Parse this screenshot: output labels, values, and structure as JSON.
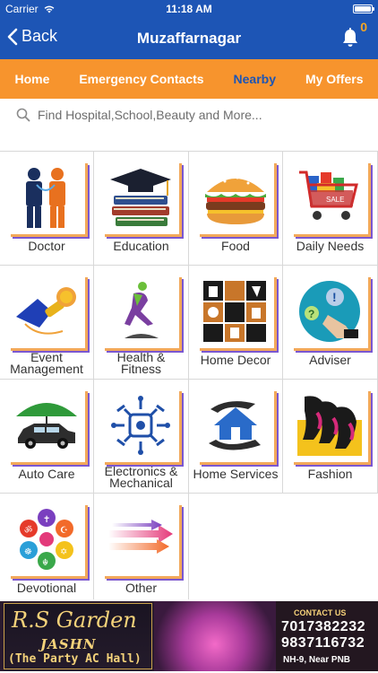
{
  "status_bar": {
    "carrier": "Carrier",
    "time": "11:18 AM"
  },
  "nav": {
    "back_label": "Back",
    "title": "Muzaffarnagar",
    "notification_count": "0"
  },
  "tabs": [
    {
      "label": "Home",
      "active": false
    },
    {
      "label": "Emergency Contacts",
      "active": false
    },
    {
      "label": "Nearby",
      "active": true
    },
    {
      "label": "My Offers",
      "active": false
    }
  ],
  "search": {
    "placeholder": "Find Hospital,School,Beauty and More..."
  },
  "categories": [
    {
      "label": "Doctor",
      "icon": "doctor-icon"
    },
    {
      "label": "Education",
      "icon": "education-icon"
    },
    {
      "label": "Food",
      "icon": "food-icon"
    },
    {
      "label": "Daily Needs",
      "icon": "daily-needs-icon"
    },
    {
      "label": "Event\nManagement",
      "icon": "event-management-icon"
    },
    {
      "label": "Health &\nFitness",
      "icon": "health-fitness-icon"
    },
    {
      "label": "Home Decor",
      "icon": "home-decor-icon"
    },
    {
      "label": "Adviser",
      "icon": "adviser-icon"
    },
    {
      "label": "Auto Care",
      "icon": "auto-care-icon"
    },
    {
      "label": "Electronics &\nMechanical",
      "icon": "electronics-icon"
    },
    {
      "label": "Home Services",
      "icon": "home-services-icon"
    },
    {
      "label": "Fashion",
      "icon": "fashion-icon"
    },
    {
      "label": "Devotional",
      "icon": "devotional-icon"
    },
    {
      "label": "Other",
      "icon": "other-icon"
    }
  ],
  "banner": {
    "brand": "R.S Garden",
    "subtitle": "JASHN",
    "tagline": "(The Party AC Hall)",
    "contact_label": "CONTACT US",
    "phone1": "7017382232",
    "phone2": "9837116732",
    "address": "NH-9, Near PNB"
  }
}
